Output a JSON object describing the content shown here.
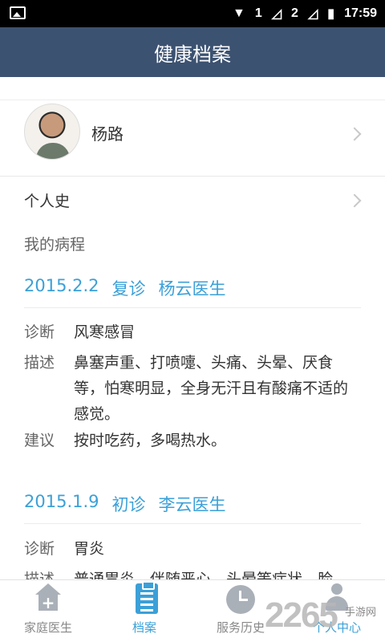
{
  "statusbar": {
    "sim1": "1",
    "sim2": "2",
    "time": "17:59"
  },
  "header": {
    "title": "健康档案"
  },
  "profile": {
    "name": "杨路"
  },
  "menu": {
    "personal_history": "个人史"
  },
  "section": {
    "my_course": "我的病程"
  },
  "visits": [
    {
      "date": "2015.2.2",
      "type": "复诊",
      "doctor": "杨云医生",
      "diagnosis_label": "诊断",
      "diagnosis": "风寒感冒",
      "desc_label": "描述",
      "desc": "鼻塞声重、打喷嚏、头痛、头晕、厌食等，怕寒明显，全身无汗且有酸痛不适的感觉。",
      "advice_label": "建议",
      "advice": "按时吃药，多喝热水。"
    },
    {
      "date": "2015.1.9",
      "type": "初诊",
      "doctor": "李云医生",
      "diagnosis_label": "诊断",
      "diagnosis": "胃炎",
      "desc_label": "描述",
      "desc": "普通胃炎，伴随恶心、头晕等症状，脸"
    }
  ],
  "tabs": [
    {
      "label": "家庭医生",
      "icon": "home-plus-icon"
    },
    {
      "label": "档案",
      "icon": "clipboard-icon"
    },
    {
      "label": "服务历史",
      "icon": "clock-icon"
    },
    {
      "label": "个人中心",
      "icon": "person-icon"
    }
  ],
  "watermark": {
    "number": "2265",
    "text": "手游网"
  },
  "colors": {
    "header": "#3c5271",
    "accent": "#3ba0d8"
  }
}
